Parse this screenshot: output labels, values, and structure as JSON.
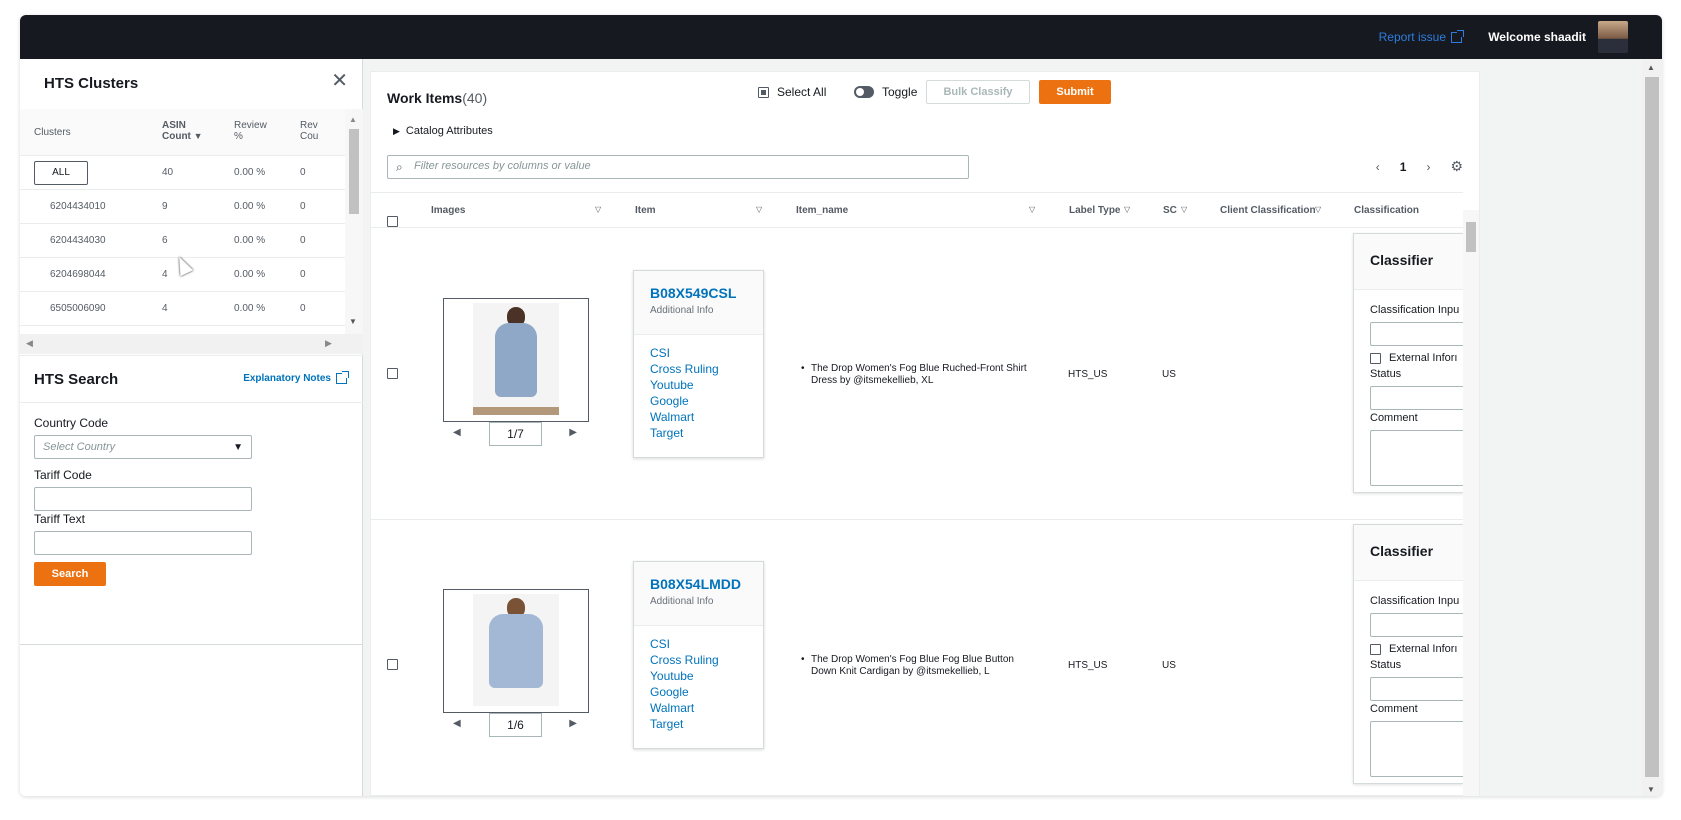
{
  "topbar": {
    "report_issue": "Report issue",
    "welcome": "Welcome shaadit"
  },
  "clusters": {
    "title": "HTS Clusters",
    "columns": [
      "Clusters",
      "ASIN Count",
      "Review %",
      "Rev Cou"
    ],
    "all_label": "ALL",
    "rows": [
      {
        "cluster": "",
        "count": "40",
        "review": "0.00 %",
        "rev": "0"
      },
      {
        "cluster": "6204434010",
        "count": "9",
        "review": "0.00 %",
        "rev": "0"
      },
      {
        "cluster": "6204434030",
        "count": "6",
        "review": "0.00 %",
        "rev": "0"
      },
      {
        "cluster": "6204698044",
        "count": "4",
        "review": "0.00 %",
        "rev": "0"
      },
      {
        "cluster": "6505006090",
        "count": "4",
        "review": "0.00 %",
        "rev": "0"
      }
    ]
  },
  "hts_search": {
    "title": "HTS Search",
    "explanatory_notes": "Explanatory Notes",
    "country_code_label": "Country Code",
    "country_placeholder": "Select Country",
    "tariff_code_label": "Tariff Code",
    "tariff_text_label": "Tariff Text",
    "search_button": "Search"
  },
  "work_items": {
    "title": "Work Items",
    "count": "(40)",
    "select_all": "Select All",
    "toggle": "Toggle",
    "bulk_classify": "Bulk Classify",
    "submit": "Submit",
    "catalog_attributes": "Catalog Attributes",
    "filter_placeholder": "Filter resources by columns or value",
    "page": "1",
    "columns": [
      "Images",
      "Item",
      "Item_name",
      "Label Type",
      "SC",
      "Client Classification",
      "Classification"
    ],
    "items": [
      {
        "image_counter": "1/7",
        "asin": "B08X549CSL",
        "additional_info": "Additional Info",
        "links": [
          "CSI",
          "Cross Ruling",
          "Youtube",
          "Google",
          "Walmart",
          "Target"
        ],
        "item_name": "The Drop Women's Fog Blue Ruched-Front Shirt Dress by @itsmekellieb, XL",
        "label_type": "HTS_US",
        "sc": "US",
        "classifier": {
          "title": "Classifier",
          "classification_input": "Classification Inpu",
          "external_info": "External Inforı",
          "status": "Status",
          "comment": "Comment"
        }
      },
      {
        "image_counter": "1/6",
        "asin": "B08X54LMDD",
        "additional_info": "Additional Info",
        "links": [
          "CSI",
          "Cross Ruling",
          "Youtube",
          "Google",
          "Walmart",
          "Target"
        ],
        "item_name": "The Drop Women's Fog Blue Fog Blue Button Down Knit Cardigan by @itsmekellieb, L",
        "label_type": "HTS_US",
        "sc": "US",
        "classifier": {
          "title": "Classifier",
          "classification_input": "Classification Inpu",
          "external_info": "External Inforı",
          "status": "Status",
          "comment": "Comment"
        }
      }
    ]
  },
  "colors": {
    "topbar_bg": "#16191f",
    "accent_orange": "#ec7211",
    "link_blue": "#0073bb"
  }
}
